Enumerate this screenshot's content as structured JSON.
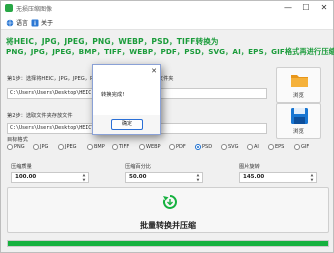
{
  "window": {
    "title": "无损压缩图像",
    "controls": [
      "—",
      "☐",
      "✕"
    ]
  },
  "menu": {
    "items": [
      {
        "label": "语言",
        "icon": "globe-icon"
      },
      {
        "label": "关于",
        "icon": "info-icon"
      }
    ]
  },
  "headline": {
    "line1": "将HEIC，JPG，JPEG，PNG，WEBP，PSD，TIFF转换为",
    "line2": "PNG，JPG，JPEG，BMP，TIFF，WEBP，PDF，PSD，SVG，AI，EPS，GIF格式再进行压缩。"
  },
  "step1": {
    "label": "第1步：选择将HEIC，JPG，JPEG，PNG，WEBP，PSD，TIFF的文件夹",
    "path": "C:\\Users\\Users\\Desktop\\HEIC",
    "browse": "浏览"
  },
  "step2": {
    "label": "第2步：选取文件夹存放文件",
    "path": "C:\\Users\\Users\\Desktop\\HEIC\\OUTPUT",
    "browse": "浏览"
  },
  "target": {
    "label": "目标格式",
    "options": [
      "PNG",
      "JPG",
      "JPEG",
      "BMP",
      "TIFF",
      "WEBP",
      "PDF",
      "PSD",
      "SVG",
      "AI",
      "EPS",
      "GIF"
    ],
    "selected": "PSD"
  },
  "settings": {
    "quality_label": "压缩质量",
    "quality_value": "100.00",
    "percent_label": "压缩百分比",
    "percent_value": "50.00",
    "rotate_label": "图片旋转",
    "rotate_value": "145.00"
  },
  "convert": {
    "label": "批量转换并压缩"
  },
  "progress": {
    "value": 1.0
  },
  "dialog": {
    "message": "转换完成!",
    "ok": "确定",
    "close": "✕"
  },
  "colors": {
    "accent": "#1a9b3a",
    "progress": "#16b13f",
    "folder": "#f5a623",
    "save": "#1976d2"
  }
}
